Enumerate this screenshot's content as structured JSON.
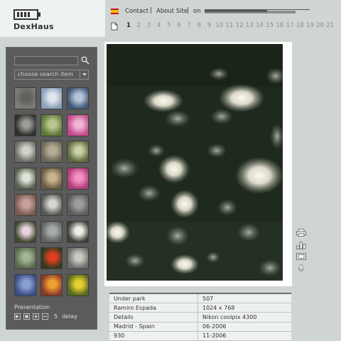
{
  "brand": {
    "name": "DexHaus"
  },
  "topbar": {
    "flag": "spain-flag-icon",
    "contact": "Contact",
    "about": "About Site",
    "separator": "|",
    "on": "on"
  },
  "pagination": {
    "pages": [
      "1",
      "2",
      "3",
      "4",
      "5",
      "6",
      "7",
      "8",
      "9",
      "10",
      "11",
      "12",
      "13",
      "14",
      "15",
      "16",
      "17",
      "18",
      "19",
      "20",
      "21"
    ],
    "current": "1"
  },
  "sidebar": {
    "search_value": "",
    "select_value": "choose search item",
    "presentation_label": "Presentation",
    "delay_value": "5",
    "delay_label": "delay",
    "thumbnail_count": 24
  },
  "colors": {
    "sidebar": "#5b5b5b",
    "background": "#cfd5d3",
    "accent": "#333333"
  },
  "info": {
    "rows": [
      [
        "Under park",
        "507"
      ],
      [
        "Ramiro Espada",
        "1024 x 768"
      ],
      [
        "Details",
        "Nikon coolpix 4300"
      ],
      [
        "Madrid - Spain",
        "06-2006"
      ],
      [
        "930",
        "11-2006"
      ]
    ]
  }
}
